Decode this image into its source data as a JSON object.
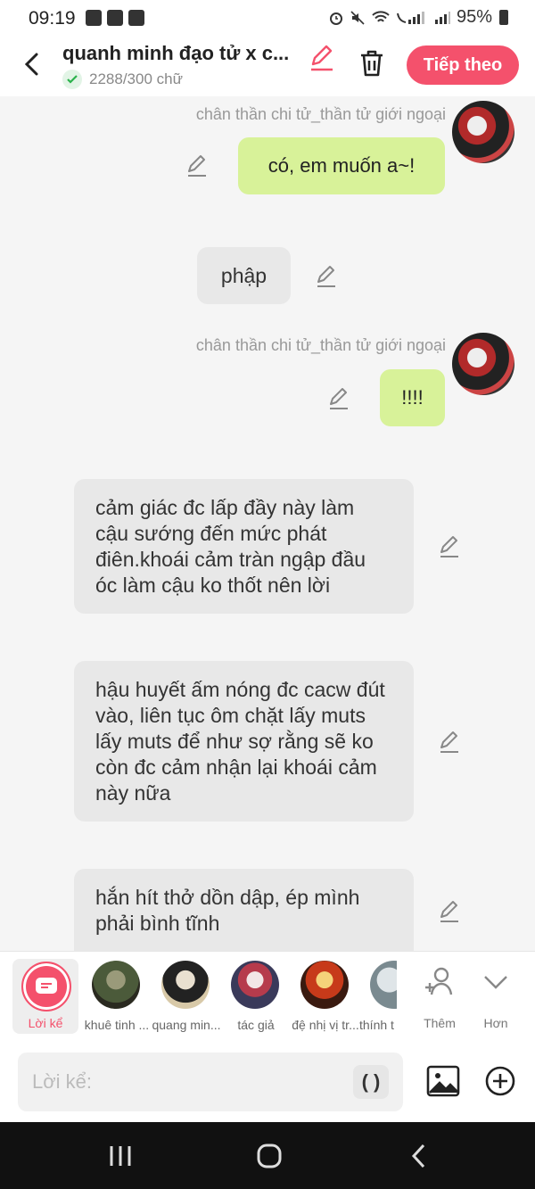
{
  "status": {
    "time": "09:19",
    "battery": "95%"
  },
  "header": {
    "title": "quanh minh đạo tử x c...",
    "word_count": "2288/300 chữ",
    "next_label": "Tiếp theo"
  },
  "messages": [
    {
      "speaker": "chân thần chi tử_thần tử giới ngoại",
      "text": "có, em muốn a~!"
    },
    {
      "text": "phập"
    },
    {
      "speaker": "chân thần chi tử_thần tử giới ngoại",
      "text": "!!!!"
    },
    {
      "text": "cảm giác đc lấp đầy này làm cậu sướng đến mức phát điên.khoái cảm tràn ngập đầu óc làm cậu ko thốt nên lời"
    },
    {
      "text": "hậu huyết ấm nóng đc cacw đút vào, liên tục ôm chặt lấy muts lấy muts để như sợ rằng sẽ ko còn đc cảm nhận lại khoái cảm này nữa"
    },
    {
      "text": "hắn hít thở dồn dập, ép mình phải bình tĩnh"
    }
  ],
  "characters": {
    "narrator": "Lời kể",
    "list": [
      "khuê tinh ...",
      "quang min...",
      "tác giả",
      "đệ nhị vị tr...",
      "thính t"
    ],
    "add_label": "Thêm",
    "more_label": "Hơn"
  },
  "input": {
    "placeholder": "Lời kể:",
    "paren": "( )"
  },
  "colors": {
    "accent": "#f4516c",
    "bubble_green": "#d8f299",
    "bubble_gray": "#e8e8e8"
  }
}
